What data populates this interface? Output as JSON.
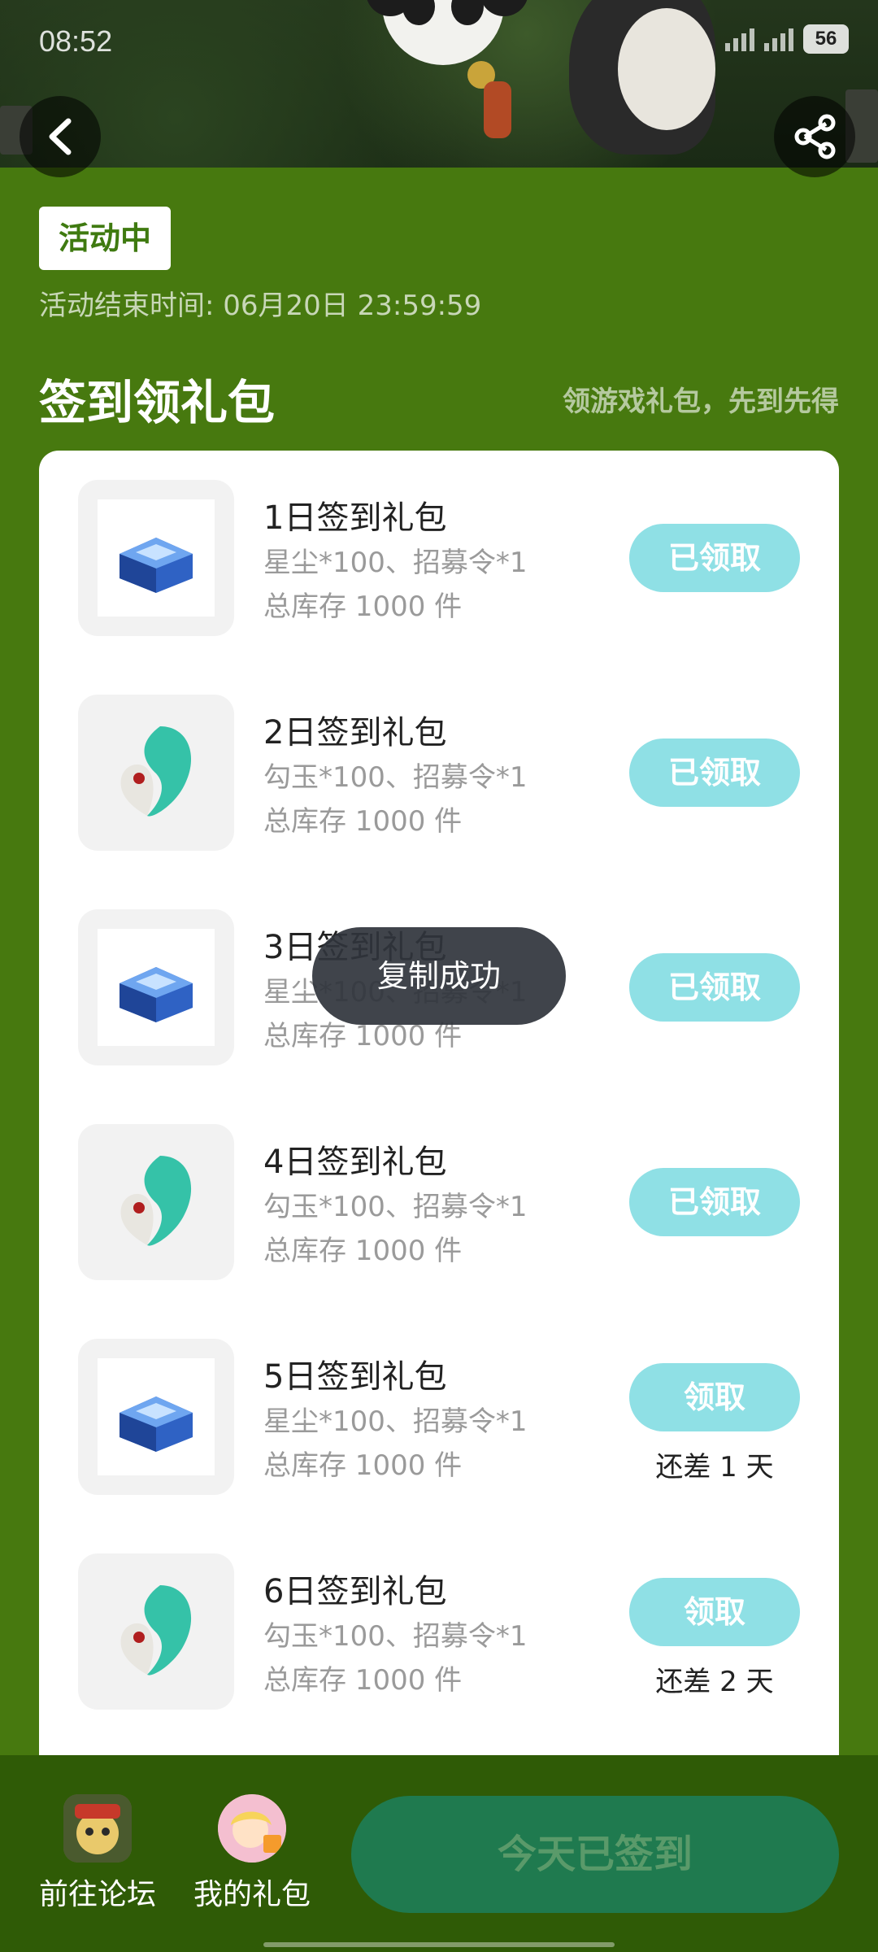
{
  "status_bar": {
    "time": "08:52",
    "battery": "56"
  },
  "campaign": {
    "status_label": "活动中",
    "end_time": "活动结束时间: 06月20日 23:59:59"
  },
  "section": {
    "title": "签到领礼包",
    "subtitle": "领游戏礼包，先到先得"
  },
  "gifts": [
    {
      "name": "1日签到礼包",
      "desc": "星尘*100、招募令*1",
      "stock": "总库存 1000 件",
      "button": "已领取",
      "days_left": "",
      "icon": "crystal-chest-icon"
    },
    {
      "name": "2日签到礼包",
      "desc": "勾玉*100、招募令*1",
      "stock": "总库存 1000 件",
      "button": "已领取",
      "days_left": "",
      "icon": "jade-magatama-icon"
    },
    {
      "name": "3日签到礼包",
      "desc": "星尘*100、招募令*1",
      "stock": "总库存 1000 件",
      "button": "已领取",
      "days_left": "",
      "icon": "crystal-chest-icon"
    },
    {
      "name": "4日签到礼包",
      "desc": "勾玉*100、招募令*1",
      "stock": "总库存 1000 件",
      "button": "已领取",
      "days_left": "",
      "icon": "jade-magatama-icon"
    },
    {
      "name": "5日签到礼包",
      "desc": "星尘*100、招募令*1",
      "stock": "总库存 1000 件",
      "button": "领取",
      "days_left": "还差 1 天",
      "icon": "crystal-chest-icon"
    },
    {
      "name": "6日签到礼包",
      "desc": "勾玉*100、招募令*1",
      "stock": "总库存 1000 件",
      "button": "领取",
      "days_left": "还差 2 天",
      "icon": "jade-magatama-icon"
    }
  ],
  "toast": "复制成功",
  "bottom_nav": {
    "forum_label": "前往论坛",
    "my_gifts_label": "我的礼包",
    "checkin_label": "今天已签到"
  },
  "colors": {
    "page_bg": "#47790f",
    "accent_green": "#3f7a10",
    "button_cyan": "#8fe0e5",
    "bottom_bar": "#2f5b06",
    "checkin_button": "#1f7a4f"
  }
}
